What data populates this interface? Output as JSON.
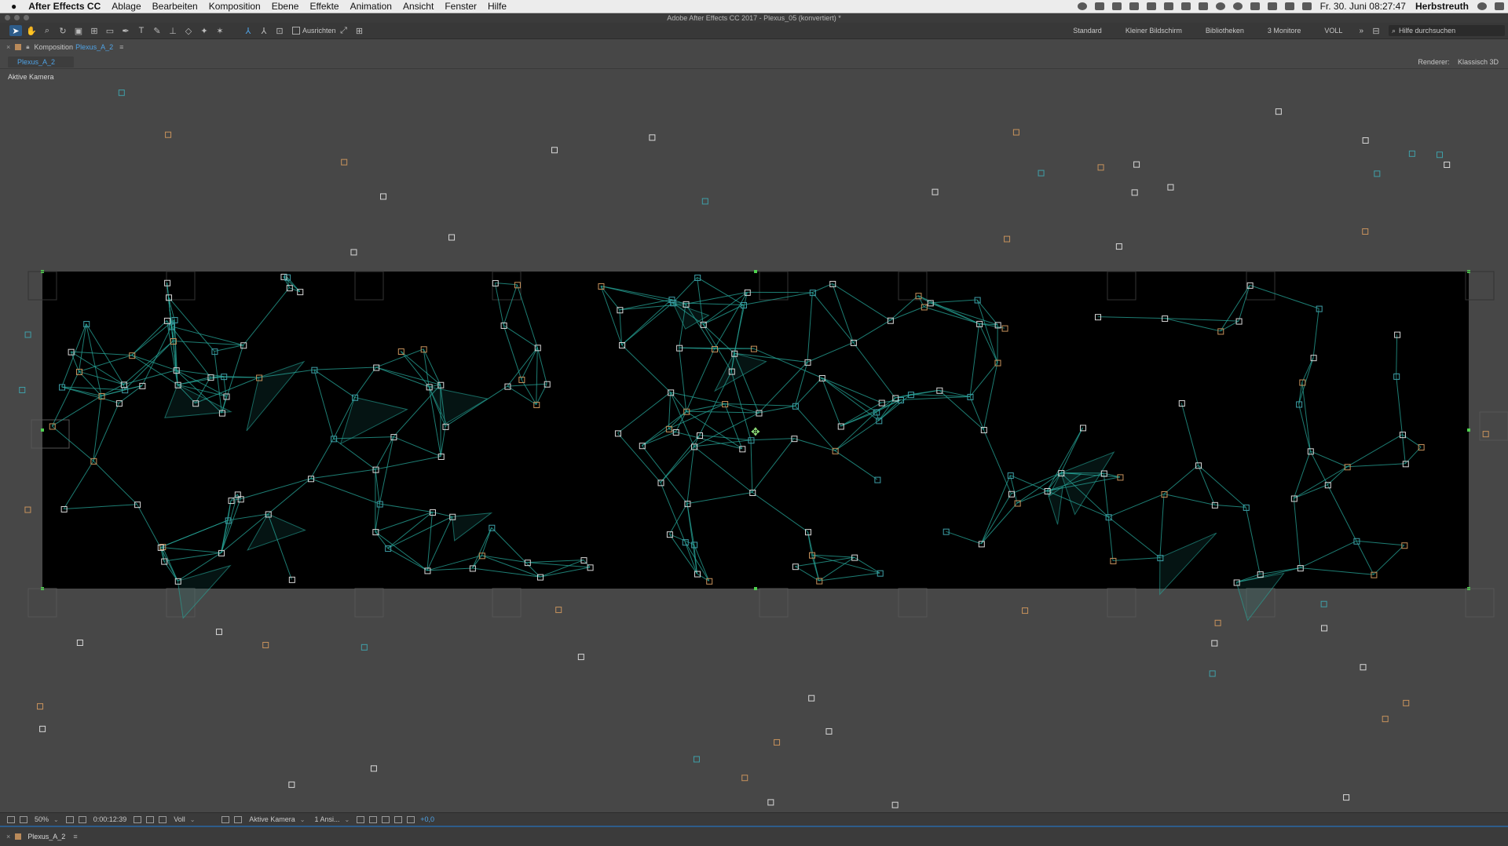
{
  "menubar": {
    "app": "After Effects CC",
    "items": [
      "Ablage",
      "Bearbeiten",
      "Komposition",
      "Ebene",
      "Effekte",
      "Animation",
      "Ansicht",
      "Fenster",
      "Hilfe"
    ],
    "clock": "Fr. 30. Juni  08:27:47",
    "user": "Herbstreuth"
  },
  "window": {
    "title": "Adobe After Effects CC 2017 - Plexus_05 (konvertiert) *"
  },
  "toolbar": {
    "align_label": "Ausrichten",
    "workspaces": [
      "Standard",
      "Kleiner Bildschirm",
      "Bibliotheken",
      "3 Monitore",
      "VOLL"
    ],
    "more": "»",
    "search_placeholder": "Hilfe durchsuchen"
  },
  "panel": {
    "prefix": "Komposition",
    "comp_name": "Plexus_A_2",
    "tab": "Plexus_A_2",
    "renderer_label": "Renderer:",
    "renderer_value": "Klassisch 3D",
    "camera_label": "Aktive Kamera"
  },
  "viewer_footer": {
    "zoom": "50%",
    "timecode": "0:00:12:39",
    "resolution": "Voll",
    "camera": "Aktive Kamera",
    "views": "1 Ansi...",
    "exposure": "+0,0"
  },
  "timeline": {
    "tab": "Plexus_A_2"
  },
  "colors": {
    "accent": "#4fa3e6",
    "plexus_line": "#27a79a",
    "point_cyan": "#3f9fa8",
    "point_orange": "#c7925c",
    "point_white": "#d8d8d8",
    "point_magenta": "#c050c8"
  }
}
